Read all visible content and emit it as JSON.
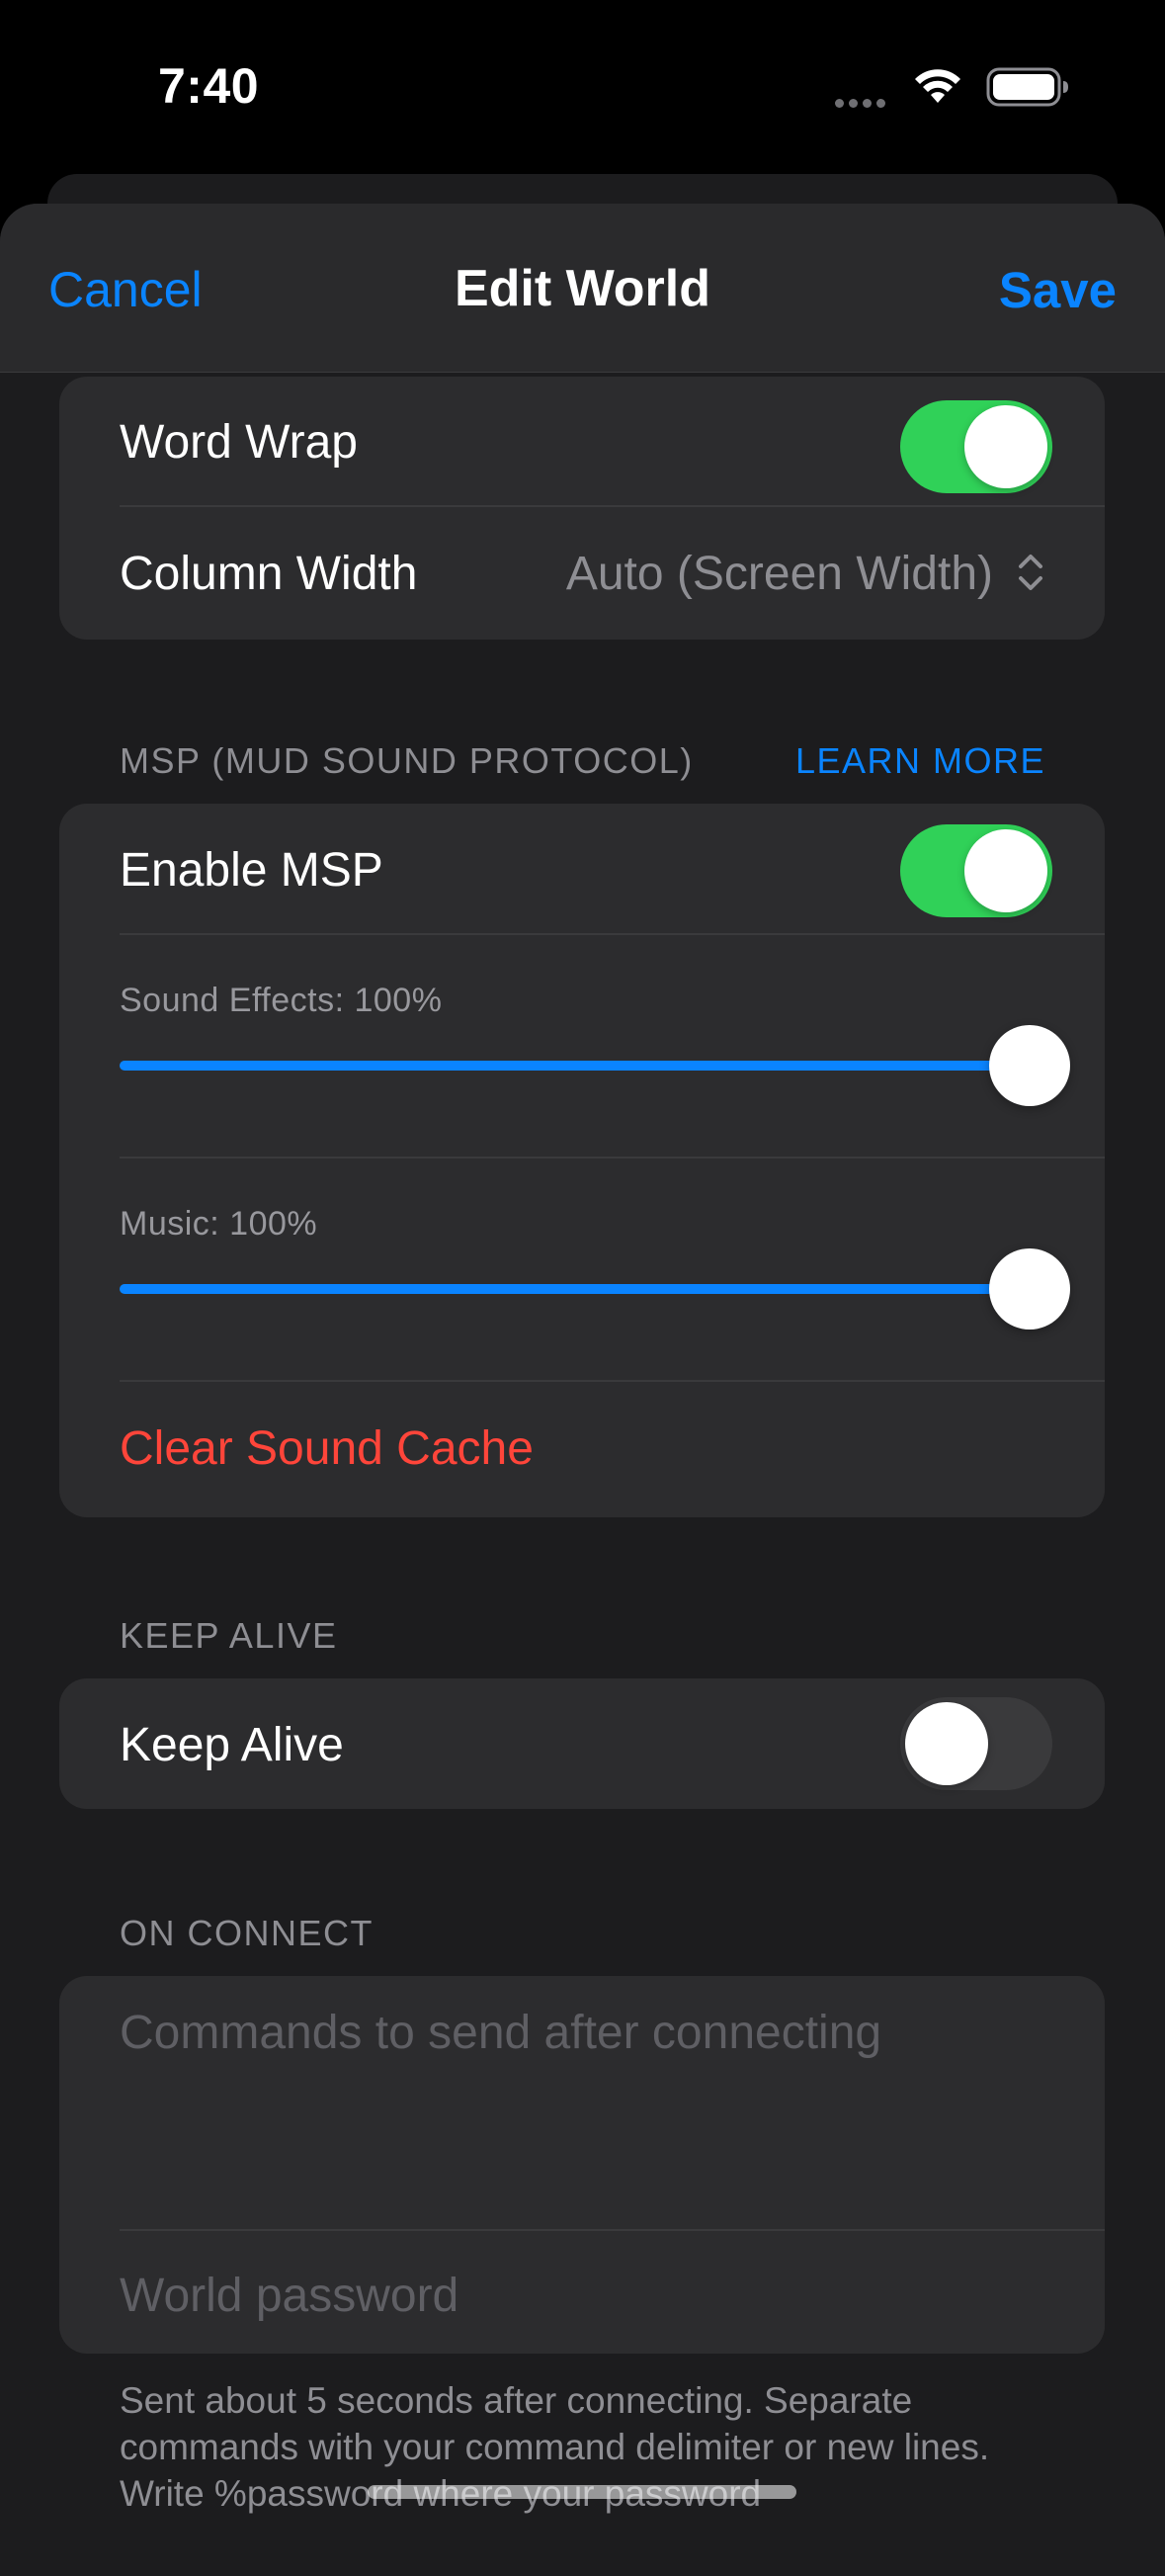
{
  "status_bar": {
    "time": "7:40"
  },
  "nav": {
    "cancel": "Cancel",
    "title": "Edit World",
    "save": "Save"
  },
  "display": {
    "word_wrap": {
      "label": "Word Wrap",
      "enabled": true
    },
    "column_width": {
      "label": "Column Width",
      "value": "Auto (Screen Width)"
    }
  },
  "msp": {
    "header": "MSP (MUD SOUND PROTOCOL)",
    "learn_more": "LEARN MORE",
    "enable": {
      "label": "Enable MSP",
      "enabled": true
    },
    "sound_effects": {
      "caption": "Sound Effects: 100%",
      "value": 1.0
    },
    "music": {
      "caption": "Music: 100%",
      "value": 1.0
    },
    "clear_cache": "Clear Sound Cache"
  },
  "keep_alive": {
    "header": "KEEP ALIVE",
    "label": "Keep Alive",
    "enabled": false
  },
  "on_connect": {
    "header": "ON CONNECT",
    "commands_placeholder": "Commands to send after connecting",
    "password_placeholder": "World password",
    "footer": "Sent about 5 seconds after connecting. Separate commands with your command delimiter or new lines. Write %password where your password"
  },
  "colors": {
    "accent": "#0a84ff",
    "toggle_on": "#30d158",
    "destructive": "#ff453a",
    "background": "#1c1c1e",
    "group": "#2c2c2e"
  },
  "icons": {
    "wifi": "wifi-icon",
    "battery": "battery-icon",
    "picker": "chevron-up-down-icon"
  }
}
